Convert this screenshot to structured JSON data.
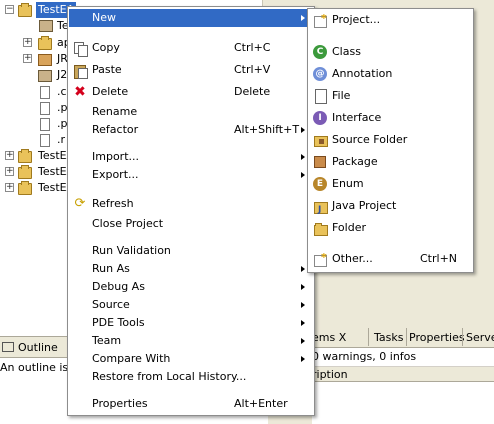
{
  "tree": {
    "selected_project": "TestEA",
    "rows": [
      {
        "label": "Te"
      },
      {
        "label": "ap"
      },
      {
        "label": "JR"
      },
      {
        "label": "J2"
      },
      {
        "label": ".c"
      },
      {
        "label": ".p"
      },
      {
        "label": ".p"
      },
      {
        "label": ".r"
      }
    ],
    "other_projects": [
      "TestEA",
      "TestEA",
      "TestEA"
    ]
  },
  "context_menu": {
    "new": "New",
    "copy": "Copy",
    "copy_acc": "Ctrl+C",
    "paste": "Paste",
    "paste_acc": "Ctrl+V",
    "delete": "Delete",
    "delete_acc": "Delete",
    "rename": "Rename",
    "refactor": "Refactor",
    "refactor_acc": "Alt+Shift+T",
    "import": "Import...",
    "export": "Export...",
    "refresh": "Refresh",
    "close_project": "Close Project",
    "run_validation": "Run Validation",
    "run_as": "Run As",
    "debug_as": "Debug As",
    "source": "Source",
    "pde_tools": "PDE Tools",
    "team": "Team",
    "compare_with": "Compare With",
    "restore": "Restore from Local History...",
    "properties": "Properties",
    "properties_acc": "Alt+Enter"
  },
  "new_submenu": {
    "project": "Project...",
    "class": "Class",
    "annotation": "Annotation",
    "file": "File",
    "interface": "Interface",
    "source_folder": "Source Folder",
    "package": "Package",
    "enum": "Enum",
    "java_project": "Java Project",
    "folder": "Folder",
    "other": "Other...",
    "other_acc": "Ctrl+N"
  },
  "outline": {
    "tab": "Outline",
    "tab_close": "X",
    "message": "An outline is no"
  },
  "problems": {
    "tab": "ems",
    "tab_close": "X",
    "tabs": [
      "Tasks",
      "Properties",
      "Serve"
    ],
    "summary": "0 warnings, 0 infos",
    "column_header": "ription"
  },
  "colors": {
    "highlight": "#316ac5",
    "menu_bg": "#ffffff",
    "chrome_bg": "#ece9d8"
  }
}
